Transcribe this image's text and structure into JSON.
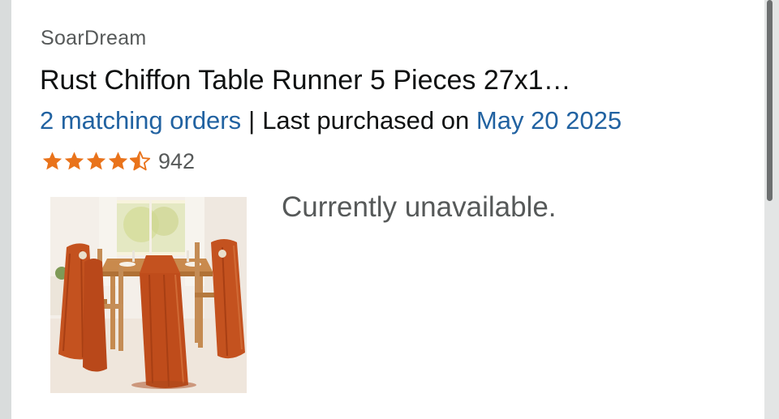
{
  "order_item": {
    "brand": "SoarDream",
    "title": "Rust Chiffon Table Runner 5 Pieces 27x1…",
    "matching_orders_link": "2 matching orders",
    "separator": "|",
    "last_purchased_label": "Last purchased on",
    "last_purchased_date": "May 20 2025",
    "rating": {
      "stars": 4.5,
      "out_of": 5,
      "count": "942"
    },
    "availability": "Currently unavailable."
  },
  "colors": {
    "link": "#2162a1",
    "star": "#e9731b",
    "text_primary": "#0f1111",
    "text_secondary": "#565959",
    "rust_fabric": "#c4521f"
  },
  "icons": {
    "star_full": "star-filled-icon",
    "star_half": "star-half-icon"
  }
}
